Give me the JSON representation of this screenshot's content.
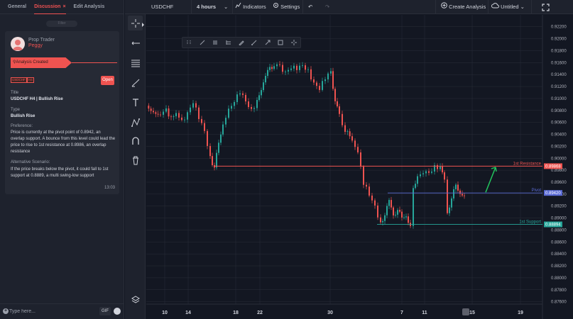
{
  "left_panel": {
    "tabs": [
      {
        "label": "General"
      },
      {
        "label": "Discussion",
        "close": "×"
      },
      {
        "label": "Edit Analysis"
      }
    ],
    "filter_label": "Filter",
    "card": {
      "author_role": "Prop Trader",
      "author_name": "Peggy",
      "banner": "Analysis Created",
      "tags": [
        "USDCHF",
        "H4"
      ],
      "open_label": "Open",
      "title_label": "Title",
      "title_value": "USDCHF H4 | Bullish Rise",
      "type_label": "Type",
      "type_value": "Bullish Rise",
      "preference_label": "Preference:",
      "preference_text": "Price is currently at the pivot point of 0.8942, an overlap support. A bounce from this level could lead the price to rise to 1st resistance  at 0.8986, an overlap resistance",
      "alt_label": "Alternative Scenario:",
      "alt_text": "If the price breaks below the pivot, it could fall to 1st support at 0.8889, a multi swing-low support",
      "time": "13:03"
    },
    "composer": {
      "placeholder": "Type here...",
      "gif_label": "GIF"
    }
  },
  "topbar": {
    "symbol": "USDCHF",
    "interval": "4 hours",
    "indicators": "Indicators",
    "settings": "Settings",
    "create_analysis": "Create Analysis",
    "layout_name": "Untitled"
  },
  "chart_data": {
    "type": "candlestick",
    "x_tick_labels": [
      "10",
      "14",
      "18",
      "22",
      "30",
      "7",
      "11",
      "15",
      "19"
    ],
    "y_tick_labels": [
      "0.92200",
      "0.92000",
      "0.91800",
      "0.91600",
      "0.91400",
      "0.91200",
      "0.91000",
      "0.90800",
      "0.90600",
      "0.90400",
      "0.90200",
      "0.90000",
      "0.89800",
      "0.89600",
      "0.89400",
      "0.89200",
      "0.89000",
      "0.88800",
      "0.88600",
      "0.88400",
      "0.88200",
      "0.88000",
      "0.87800",
      "0.87600"
    ],
    "ylim": [
      0.8756,
      0.9228
    ],
    "levels": [
      {
        "name": "1st Resistance",
        "value": 0.89868,
        "label": "0.89868",
        "color": "#ef5350"
      },
      {
        "name": "Pivot",
        "value": 0.8942,
        "label": "0.89420",
        "color": "#5b6bd6"
      },
      {
        "name": "1st Support",
        "value": 0.88894,
        "label": "0.88894",
        "color": "#26a69a"
      }
    ],
    "colors": {
      "up": "#26a69a",
      "down": "#ef5350",
      "forecast_arrow": "#22c55e",
      "grid": "#2a2e39"
    },
    "price_path": [
      [
        0,
        0.9088
      ],
      [
        10,
        0.9083
      ],
      [
        20,
        0.9072
      ],
      [
        28,
        0.9078
      ],
      [
        35,
        0.907
      ],
      [
        42,
        0.9074
      ],
      [
        50,
        0.906
      ],
      [
        58,
        0.908
      ],
      [
        66,
        0.9098
      ],
      [
        74,
        0.9066
      ],
      [
        82,
        0.904
      ],
      [
        90,
        0.9
      ],
      [
        96,
        0.8988
      ],
      [
        102,
        0.902
      ],
      [
        108,
        0.906
      ],
      [
        116,
        0.9085
      ],
      [
        124,
        0.91
      ],
      [
        132,
        0.911
      ],
      [
        140,
        0.909
      ],
      [
        148,
        0.9078
      ],
      [
        156,
        0.91
      ],
      [
        162,
        0.912
      ],
      [
        168,
        0.9135
      ],
      [
        174,
        0.915
      ],
      [
        180,
        0.916
      ],
      [
        188,
        0.9152
      ],
      [
        196,
        0.9148
      ],
      [
        204,
        0.9156
      ],
      [
        212,
        0.9148
      ],
      [
        220,
        0.915
      ],
      [
        228,
        0.9145
      ],
      [
        236,
        0.913
      ],
      [
        244,
        0.912
      ],
      [
        252,
        0.9132
      ],
      [
        260,
        0.914
      ],
      [
        266,
        0.9092
      ],
      [
        272,
        0.9072
      ],
      [
        280,
        0.905
      ],
      [
        290,
        0.9035
      ],
      [
        298,
        0.9015
      ],
      [
        306,
        0.896
      ],
      [
        314,
        0.8935
      ],
      [
        322,
        0.8915
      ],
      [
        330,
        0.8892
      ],
      [
        336,
        0.891
      ],
      [
        342,
        0.8925
      ],
      [
        348,
        0.8905
      ],
      [
        354,
        0.8918
      ],
      [
        360,
        0.8895
      ],
      [
        366,
        0.8905
      ],
      [
        372,
        0.889
      ],
      [
        376,
        0.8945
      ],
      [
        382,
        0.8965
      ],
      [
        390,
        0.8975
      ],
      [
        398,
        0.897
      ],
      [
        406,
        0.8985
      ],
      [
        414,
        0.899
      ],
      [
        420,
        0.897
      ],
      [
        424,
        0.891
      ],
      [
        430,
        0.8935
      ],
      [
        436,
        0.895
      ],
      [
        442,
        0.8945
      ],
      [
        448,
        0.8938
      ]
    ],
    "forecast_arrow": {
      "from": [
        478,
        0.8943
      ],
      "to": [
        492,
        0.8985
      ]
    }
  }
}
